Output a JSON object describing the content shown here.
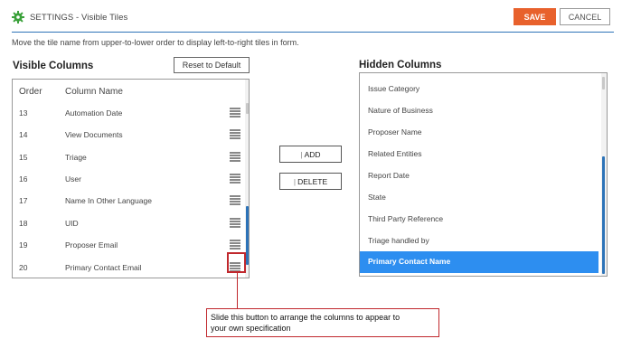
{
  "header": {
    "title": "SETTINGS - Visible Tiles",
    "save_label": "SAVE",
    "cancel_label": "CANCEL",
    "accent_color": "#e8612c",
    "line_color": "#2d73b8"
  },
  "instruction": "Move the tile name from upper-to-lower order to display left-to-right tiles in form.",
  "visible_columns": {
    "heading": "Visible Columns",
    "reset_label": "Reset to Default",
    "col_order": "Order",
    "col_name": "Column Name",
    "rows": [
      {
        "order": "13",
        "name": "Automation Date"
      },
      {
        "order": "14",
        "name": "View Documents"
      },
      {
        "order": "15",
        "name": "Triage"
      },
      {
        "order": "16",
        "name": "User"
      },
      {
        "order": "17",
        "name": "Name In Other Language"
      },
      {
        "order": "18",
        "name": "UID"
      },
      {
        "order": "19",
        "name": "Proposer Email"
      },
      {
        "order": "20",
        "name": "Primary Contact Email"
      }
    ]
  },
  "actions": {
    "add_label": "ADD",
    "delete_label": "DELETE"
  },
  "hidden_columns": {
    "heading": "Hidden Columns",
    "selected_color": "#2d8ef0",
    "items": [
      "Issue Category",
      "Nature of Business",
      "Proposer Name",
      "Related Entities",
      "Report Date",
      "State",
      "Third Party Reference",
      "Triage handled by",
      "Primary Contact Name"
    ],
    "selected_index": 8
  },
  "annotation": {
    "text_line1": "Slide this button to arrange the columns to appear to",
    "text_line2": "your own specification",
    "color": "#c0282d"
  }
}
